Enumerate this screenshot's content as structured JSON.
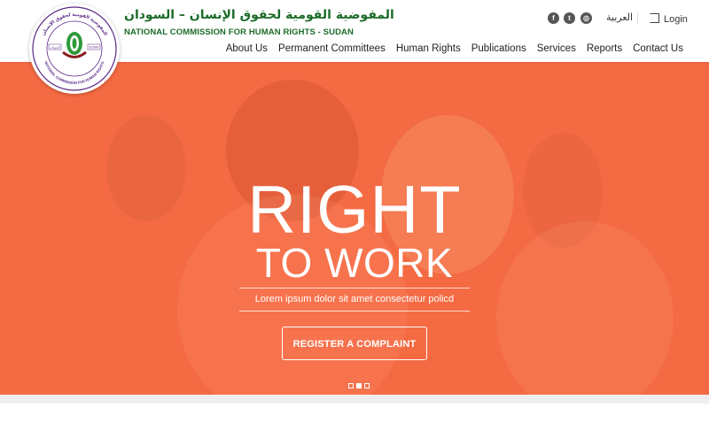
{
  "org": {
    "name_ar": "المفوضية القومية لحقوق الإنسان – السودان",
    "name_en": "NATIONAL COMMISSION FOR HUMAN RIGHTS - SUDAN",
    "seal_text_en": "NATIONAL COMMISSION FOR HUMAN RIGHTS",
    "seal_text_ar": "المفوضية القومية لحقوق الإنسان",
    "seal_sudan": "SUDAN",
    "seal_sudan_ar": "السودان"
  },
  "topbar": {
    "social": [
      {
        "name": "facebook",
        "glyph": "f"
      },
      {
        "name": "twitter",
        "glyph": "t"
      },
      {
        "name": "instagram",
        "glyph": "◎"
      }
    ],
    "language": "العربية",
    "login": "Login"
  },
  "nav": {
    "items": [
      "About Us",
      "Permanent Committees",
      "Human Rights",
      "Publications",
      "Services",
      "Reports",
      "Contact Us"
    ]
  },
  "hero": {
    "headline_1": "RIGHT",
    "headline_2": "TO WORK",
    "tagline": "Lorem ipsum dolor sit amet consectetur policd",
    "cta": "REGISTER A COMPLAINT",
    "slides": 3,
    "active_slide": 2
  },
  "colors": {
    "brand_green": "#1c6b2a",
    "hero_orange": "#f46a43",
    "seal_purple": "#5b2a86"
  }
}
